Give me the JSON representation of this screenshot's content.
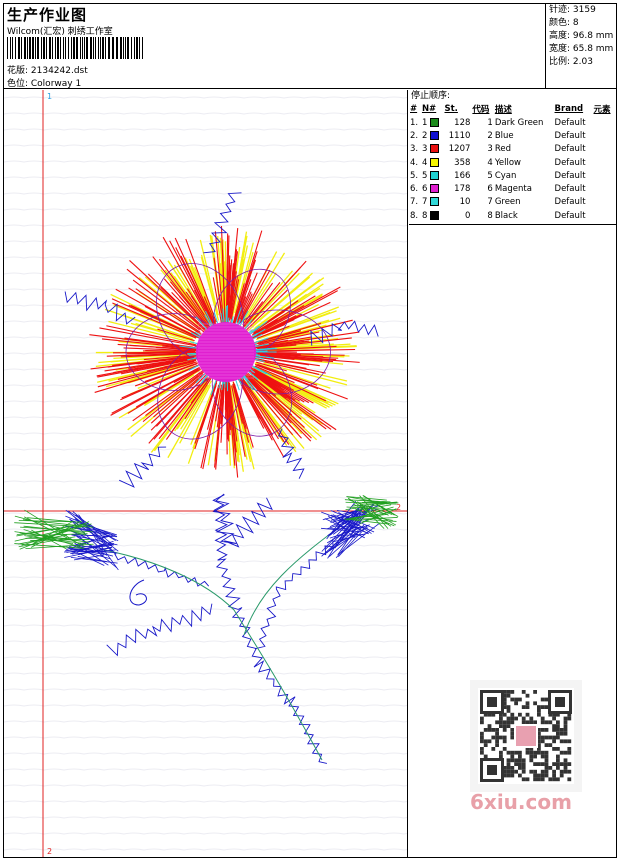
{
  "header": {
    "title": "生产作业图",
    "software": "Wilcom(汇宏) 刺绣工作室",
    "design_label": "花版: 2134242.dst",
    "colorway_label": "色位: Colorway 1"
  },
  "stats": {
    "stitches": "针迹: 3159",
    "colors": "颜色: 8",
    "height": "高度: 96.8 mm",
    "width": "宽度: 65.8 mm",
    "ratio": "比例: 2.03"
  },
  "stop_sequence": {
    "heading": "停止顺序:",
    "columns": [
      "#",
      "N#",
      "St.",
      "代码",
      "描述",
      "Brand",
      "元素"
    ],
    "rows": [
      {
        "idx": "1.",
        "n": "1",
        "color": "#1a8a1a",
        "st": "128",
        "code": "1",
        "desc": "Dark Green",
        "brand": "Default"
      },
      {
        "idx": "2.",
        "n": "2",
        "color": "#1010d0",
        "st": "1110",
        "code": "2",
        "desc": "Blue",
        "brand": "Default"
      },
      {
        "idx": "3.",
        "n": "3",
        "color": "#e81010",
        "st": "1207",
        "code": "3",
        "desc": "Red",
        "brand": "Default"
      },
      {
        "idx": "4.",
        "n": "4",
        "color": "#f5f500",
        "st": "358",
        "code": "4",
        "desc": "Yellow",
        "brand": "Default"
      },
      {
        "idx": "5.",
        "n": "5",
        "color": "#20d0d0",
        "st": "166",
        "code": "5",
        "desc": "Cyan",
        "brand": "Default"
      },
      {
        "idx": "6.",
        "n": "6",
        "color": "#e020d0",
        "st": "178",
        "code": "6",
        "desc": "Magenta",
        "brand": "Default"
      },
      {
        "idx": "7.",
        "n": "7",
        "color": "#30d8d8",
        "st": "10",
        "code": "7",
        "desc": "Green",
        "brand": "Default"
      },
      {
        "idx": "8.",
        "n": "8",
        "color": "#000000",
        "st": "0",
        "code": "8",
        "desc": "Black",
        "brand": "Default"
      }
    ]
  },
  "axes": {
    "v_top": "1",
    "v_bottom": "2",
    "h_right": "2"
  },
  "watermark": {
    "logo_text": "6xiu.com"
  },
  "palette": {
    "axis_red": "#e02020",
    "stem_blue": "#1818c8",
    "petal_red": "#ee1111",
    "petal_yellow": "#f2ee10",
    "center_magenta": "#e020d0",
    "center_cyan": "#30d0e0",
    "leaf_green": "#22a022"
  }
}
